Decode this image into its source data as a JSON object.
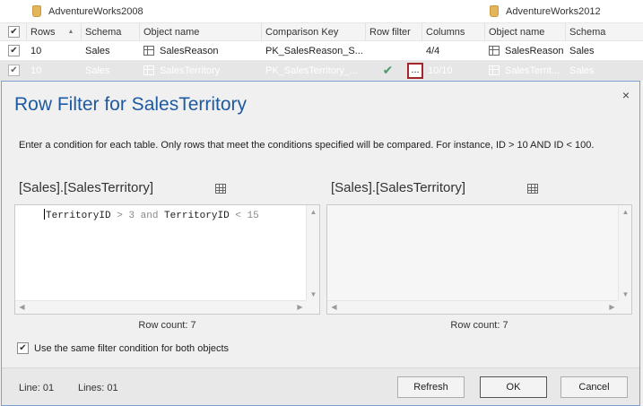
{
  "grid": {
    "left_db": "AdventureWorks2008",
    "right_db": "AdventureWorks2012",
    "columns": [
      "Rows",
      "Schema",
      "Object name",
      "Comparison Key",
      "Row filter",
      "Columns",
      "Object name",
      "Schema"
    ],
    "rows": [
      {
        "checked": true,
        "rows": "10",
        "schema": "Sales",
        "object_name": "SalesReason",
        "comparison_key": "PK_SalesReason_S...",
        "row_filter": "",
        "columns": "4/4",
        "right_object_name": "SalesReason",
        "right_schema": "Sales"
      },
      {
        "checked": true,
        "rows": "10",
        "schema": "Sales",
        "object_name": "SalesTerritory",
        "comparison_key": "PK_SalesTerritory_...",
        "row_filter": "✔",
        "row_filter_button": "...",
        "columns": "10/10",
        "right_object_name": "SalesTerrit...",
        "right_schema": "Sales"
      }
    ]
  },
  "dialog": {
    "title": "Row Filter for SalesTerritory",
    "instructions": "Enter a condition for each table. Only rows that meet the conditions specified will be compared. For instance, ID > 10 AND ID < 100.",
    "left_pane": {
      "title": "[Sales].[SalesTerritory]",
      "filter_tokens": [
        "TerritoryID",
        " > 3 ",
        "and",
        " TerritoryID",
        " < 15"
      ],
      "row_count": "Row count: 7"
    },
    "right_pane": {
      "title": "[Sales].[SalesTerritory]",
      "filter_text": "",
      "row_count": "Row count: 7"
    },
    "same_filter_checked": true,
    "same_filter_label": "Use the same filter condition for both objects",
    "line_label": "Line: 01",
    "lines_label": "Lines: 01",
    "buttons": {
      "refresh": "Refresh",
      "ok": "OK",
      "cancel": "Cancel"
    },
    "close_glyph": "×"
  }
}
